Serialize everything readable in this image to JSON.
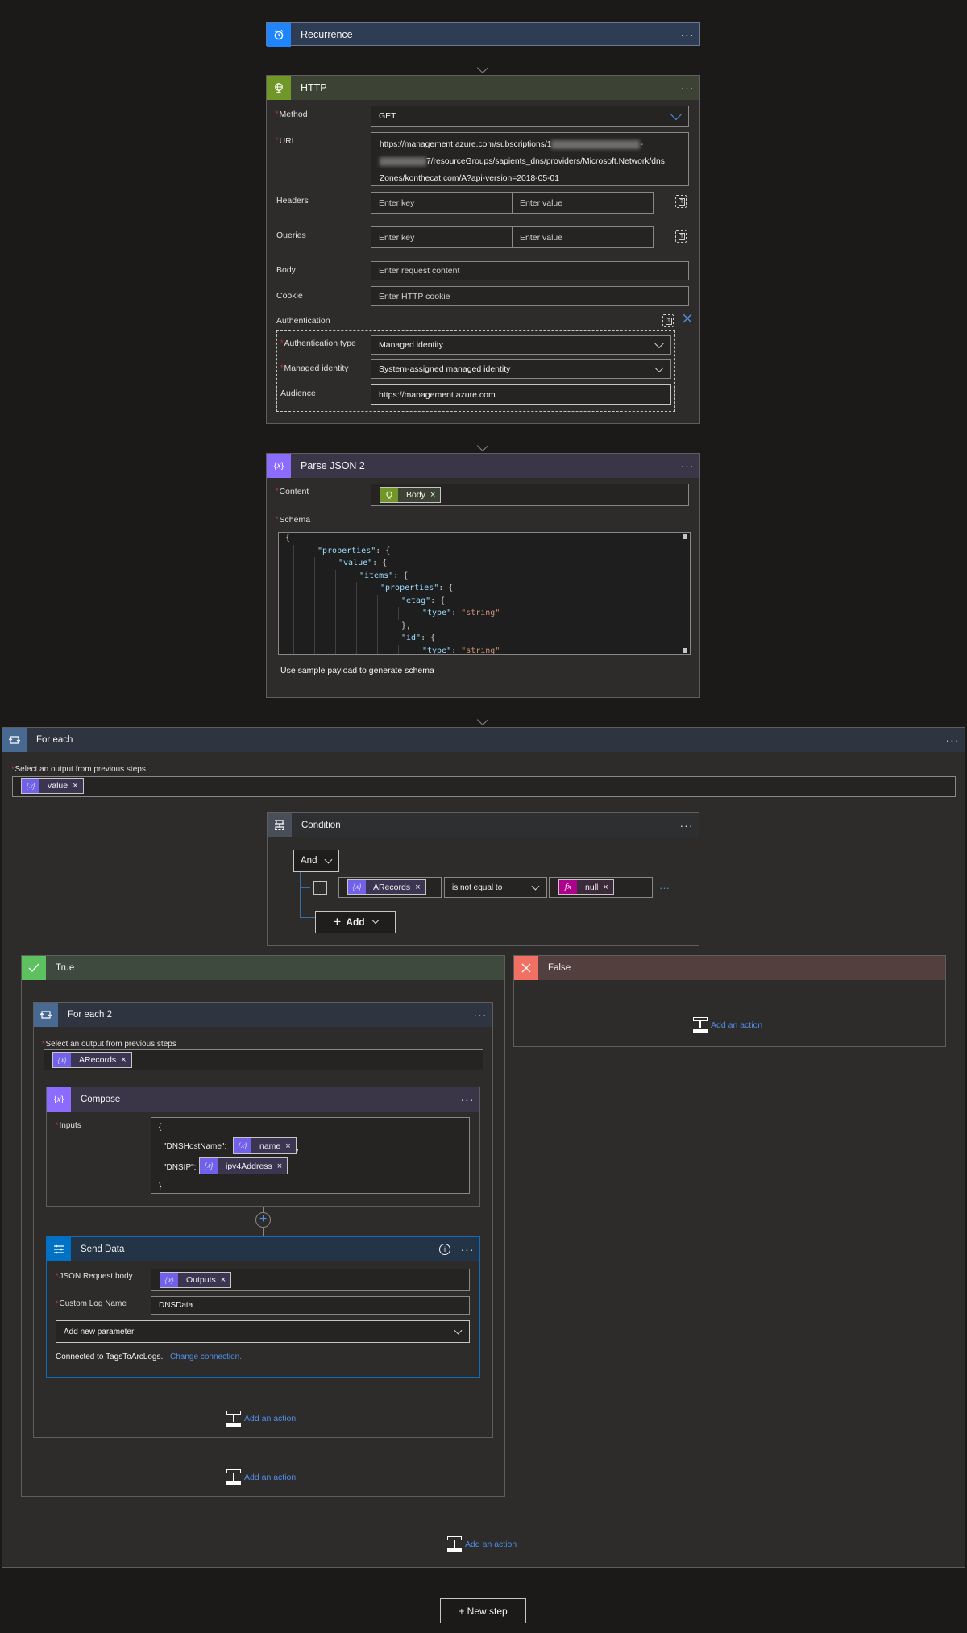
{
  "colors": {
    "recurrence_accent": "#1f85ff",
    "http_accent": "#709727",
    "json_accent": "#8c6cff",
    "foreach_accent": "#486991",
    "condition_accent": "#484f58",
    "true_accent": "#5ec160",
    "false_accent": "#f07064",
    "send_data_accent": "#0072c6",
    "expression_accent": "#ad008c",
    "link": "#4f8ee8"
  },
  "recurrence": {
    "title": "Recurrence",
    "icon": "alarm-clock-icon",
    "more": "···"
  },
  "http": {
    "title": "HTTP",
    "icon": "globe-icon",
    "more": "···",
    "method": {
      "label": "Method",
      "required": "*",
      "value": "GET"
    },
    "uri": {
      "label": "URI",
      "required": "*",
      "line1": "https://management.azure.com/subscriptions/1",
      "line1_tail": "-",
      "line2": "7/resourceGroups/sapients_dns/providers/Microsoft.Network/dns",
      "line3": "Zones/konthecat.com/A?api-version=2018-05-01"
    },
    "headers": {
      "label": "Headers",
      "key_placeholder": "Enter key",
      "value_placeholder": "Enter value"
    },
    "queries": {
      "label": "Queries",
      "key_placeholder": "Enter key",
      "value_placeholder": "Enter value"
    },
    "body": {
      "label": "Body",
      "placeholder": "Enter request content"
    },
    "cookie": {
      "label": "Cookie",
      "placeholder": "Enter HTTP cookie"
    },
    "authentication": {
      "label": "Authentication",
      "type": {
        "label": "Authentication type",
        "required": "*",
        "value": "Managed identity"
      },
      "managed_identity": {
        "label": "Managed identity",
        "required": "*",
        "value": "System-assigned managed identity"
      },
      "audience": {
        "label": "Audience",
        "value": "https://management.azure.com"
      }
    }
  },
  "parse_json": {
    "title": "Parse JSON 2",
    "icon": "braces-variable-icon",
    "icon_glyph": "{𝑥}",
    "more": "···",
    "content": {
      "label": "Content",
      "required": "*",
      "token": "Body"
    },
    "schema": {
      "label": "Schema",
      "required": "*",
      "lines": [
        {
          "indent": 0,
          "parts": [
            {
              "c": "p",
              "t": "{"
            }
          ]
        },
        {
          "indent": 1,
          "parts": [
            {
              "c": "k",
              "t": "\"properties\""
            },
            {
              "c": "p",
              "t": ": {"
            }
          ]
        },
        {
          "indent": 2,
          "parts": [
            {
              "c": "k",
              "t": "\"value\""
            },
            {
              "c": "p",
              "t": ": {"
            }
          ]
        },
        {
          "indent": 3,
          "parts": [
            {
              "c": "k",
              "t": "\"items\""
            },
            {
              "c": "p",
              "t": ": {"
            }
          ]
        },
        {
          "indent": 4,
          "parts": [
            {
              "c": "k",
              "t": "\"properties\""
            },
            {
              "c": "p",
              "t": ": {"
            }
          ]
        },
        {
          "indent": 5,
          "parts": [
            {
              "c": "k",
              "t": "\"etag\""
            },
            {
              "c": "p",
              "t": ": {"
            }
          ]
        },
        {
          "indent": 6,
          "parts": [
            {
              "c": "k",
              "t": "\"type\""
            },
            {
              "c": "p",
              "t": ": "
            },
            {
              "c": "s",
              "t": "\"string\""
            }
          ]
        },
        {
          "indent": 5,
          "parts": [
            {
              "c": "p",
              "t": "},"
            }
          ]
        },
        {
          "indent": 5,
          "parts": [
            {
              "c": "k",
              "t": "\"id\""
            },
            {
              "c": "p",
              "t": ": {"
            }
          ]
        },
        {
          "indent": 6,
          "parts": [
            {
              "c": "k",
              "t": "\"type\""
            },
            {
              "c": "p",
              "t": ": "
            },
            {
              "c": "s",
              "t": "\"string\""
            }
          ]
        }
      ]
    },
    "sample_payload_link": "Use sample payload to generate schema"
  },
  "for_each": {
    "title": "For each",
    "icon": "loop-icon",
    "more": "···",
    "select_label": "Select an output from previous steps",
    "required": "*",
    "token": "value",
    "add_action": "Add an action"
  },
  "condition": {
    "title": "Condition",
    "icon": "condition-icon",
    "more": "···",
    "group_operator": "And",
    "row": {
      "left_token": "ARecords",
      "operator": "is not equal to",
      "right_token": "null",
      "right_token_icon": "fx"
    },
    "add_label": "Add",
    "row_more": "···"
  },
  "true_branch": {
    "title": "True",
    "icon": "check-icon",
    "add_action": "Add an action"
  },
  "false_branch": {
    "title": "False",
    "icon": "close-icon",
    "add_action": "Add an action"
  },
  "for_each_2": {
    "title": "For each 2",
    "more": "···",
    "select_label": "Select an output from previous steps",
    "required": "*",
    "token": "ARecords",
    "add_action": "Add an action"
  },
  "compose": {
    "title": "Compose",
    "more": "···",
    "inputs_label": "Inputs",
    "required": "*",
    "open_brace": "{",
    "close_brace": "}",
    "host_key": "\"DNSHostName\":",
    "host_token": "name",
    "host_suffix": ",",
    "ip_key": "\"DNSIP\":",
    "ip_token": "ipv4Address"
  },
  "send_data": {
    "title": "Send Data",
    "more": "···",
    "json_body": {
      "label": "JSON Request body",
      "required": "*",
      "token": "Outputs"
    },
    "log_name": {
      "label": "Custom Log Name",
      "required": "*",
      "value": "DNSData"
    },
    "add_param": "Add new parameter",
    "connected_text": "Connected to TagsToArcLogs.",
    "change_connection": "Change connection."
  },
  "new_step": "+ New step"
}
